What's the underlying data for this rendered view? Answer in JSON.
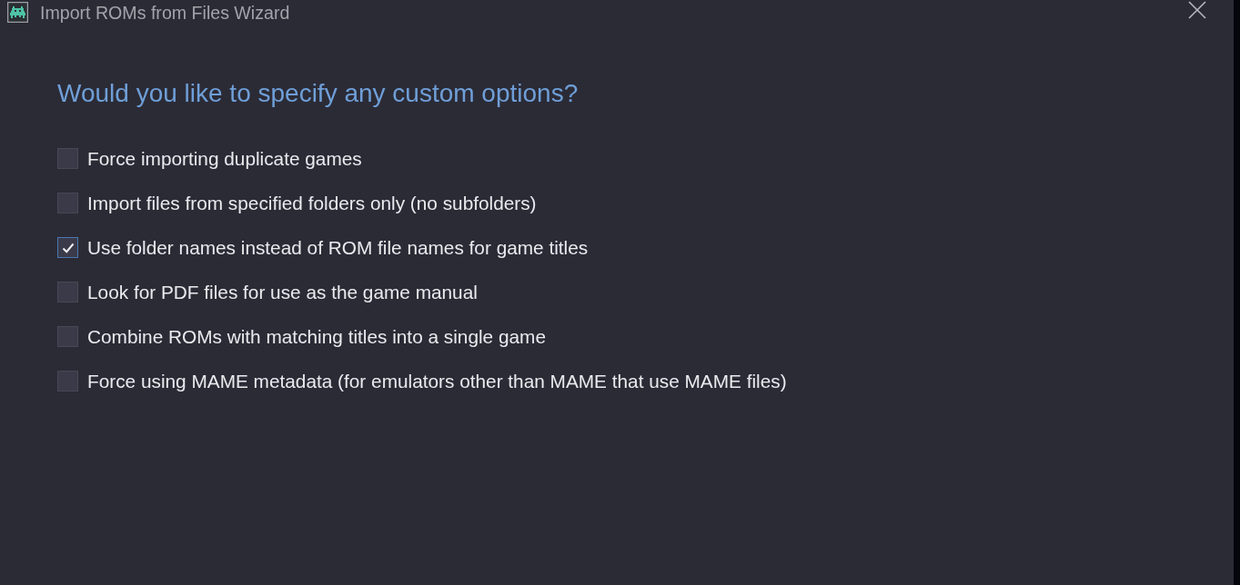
{
  "window": {
    "title": "Import ROMs from Files Wizard"
  },
  "heading": "Would you like to specify any custom options?",
  "options": [
    {
      "label": "Force importing duplicate games",
      "checked": false
    },
    {
      "label": "Import files from specified folders only (no subfolders)",
      "checked": false
    },
    {
      "label": "Use folder names instead of ROM file names for game titles",
      "checked": true
    },
    {
      "label": "Look for PDF files for use as the game manual",
      "checked": false
    },
    {
      "label": "Combine ROMs with matching titles into a single game",
      "checked": false
    },
    {
      "label": "Force using MAME metadata (for emulators other than MAME that use MAME files)",
      "checked": false
    }
  ]
}
